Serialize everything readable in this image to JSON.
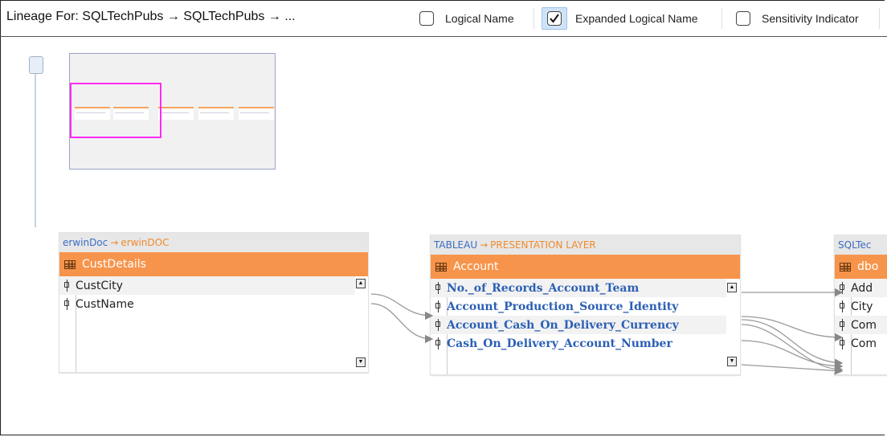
{
  "toolbar": {
    "lineage_title": "Lineage For: SQLTechPubs → SQLTechPubs → ...",
    "options": [
      {
        "label": "Logical Name",
        "checked": false
      },
      {
        "label": "Expanded Logical Name",
        "checked": true
      },
      {
        "label": "Sensitivity Indicator",
        "checked": false
      }
    ]
  },
  "entities": [
    {
      "system": "erwinDoc",
      "environment": "erwinDOC",
      "table": "CustDetails",
      "columns": [
        "CustCity",
        "CustName"
      ]
    },
    {
      "system": "TABLEAU",
      "environment": "PRESENTATION LAYER",
      "table": "Account",
      "columns": [
        "No._of_Records_Account_Team",
        "Account_Production_Source_Identity",
        "Account_Cash_On_Delivery_Currency",
        "Cash_On_Delivery_Account_Number"
      ]
    },
    {
      "system": "SQLTec",
      "environment": "",
      "table": "dbo",
      "columns": [
        "Add",
        "City",
        "Com",
        "Com"
      ]
    }
  ],
  "colors": {
    "header_orange": "#f7944b",
    "environment_orange": "#f08a2c",
    "system_blue": "#3a6cc4",
    "viewport_magenta": "#ff2bf0"
  }
}
